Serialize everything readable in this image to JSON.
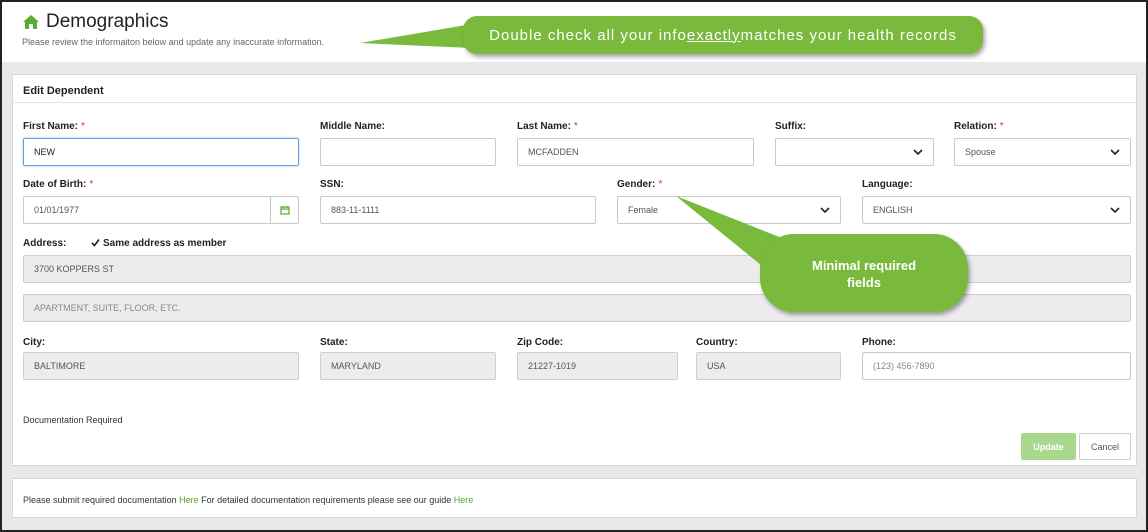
{
  "header": {
    "title": "Demographics",
    "subtitle": "Please review the informaiton below and update any inaccurate information."
  },
  "callouts": {
    "top_before": "Double check all your info ",
    "top_emph": "exactly",
    "top_after": " matches your health records",
    "mid_line1": "Minimal required",
    "mid_line2": "fields"
  },
  "form": {
    "heading": "Edit Dependent",
    "required_mark": "*",
    "labels": {
      "first_name": "First Name:",
      "middle_name": "Middle Name:",
      "last_name": "Last Name:",
      "suffix": "Suffix:",
      "relation": "Relation:",
      "dob": "Date of Birth:",
      "ssn": "SSN:",
      "gender": "Gender:",
      "language": "Language:",
      "address": "Address:",
      "same_address": "Same address as member",
      "city": "City:",
      "state": "State:",
      "zip": "Zip Code:",
      "country": "Country:",
      "phone": "Phone:"
    },
    "values": {
      "first_name": "NEW",
      "middle_name": "",
      "last_name": "MCFADDEN",
      "suffix": "",
      "relation": "Spouse",
      "dob": "01/01/1977",
      "ssn": "883-11-1111",
      "gender": "Female",
      "language": "ENGLISH",
      "address1": "3700 KOPPERS ST",
      "address2_placeholder": "APARTMENT, SUITE, FLOOR, ETC.",
      "city": "BALTIMORE",
      "state": "MARYLAND",
      "zip": "21227-1019",
      "country": "USA",
      "phone_placeholder": "(123) 456-7890"
    },
    "same_address_checked": true,
    "doc_required": "Documentation Required",
    "buttons": {
      "update": "Update",
      "cancel": "Cancel"
    }
  },
  "footer": {
    "text1": "Please submit required documentation ",
    "link1": "Here",
    "text2": " For detailed documentation requirements please see our guide ",
    "link2": "Here"
  },
  "colors": {
    "accent_green": "#79b93c",
    "link_green": "#55a530",
    "update_button": "#a9d88c",
    "required": "#dd3333"
  },
  "icons": [
    "home-icon",
    "calendar-icon",
    "chevron-down-icon",
    "checkmark-icon"
  ]
}
